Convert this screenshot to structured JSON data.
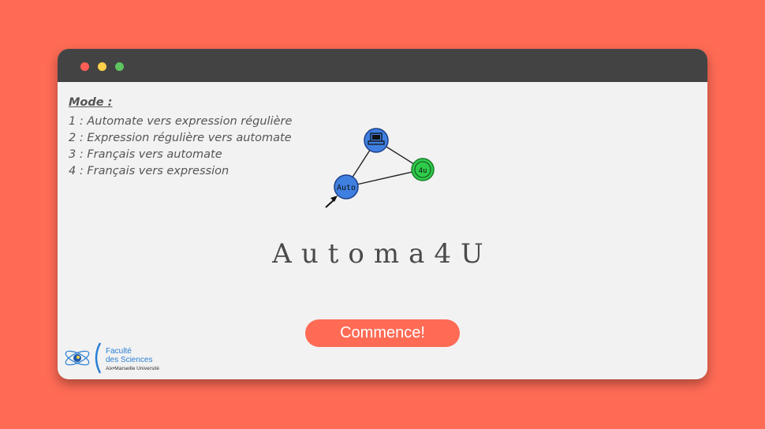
{
  "window": {
    "controls": [
      "close",
      "minimize",
      "maximize"
    ]
  },
  "mode": {
    "title": "Mode :",
    "options": [
      "1 : Automate vers expression régulière",
      "2 : Expression régulière vers automate",
      "3 : Français vers automate",
      "4 : Français vers expression"
    ]
  },
  "graph": {
    "nodes": [
      "laptop",
      "4u",
      "Auto"
    ],
    "labels": {
      "start": "Auto",
      "final": "4u"
    }
  },
  "app": {
    "title": "Automa4U",
    "start_button": "Commence!"
  },
  "logo": {
    "line1": "Faculté",
    "line2": "des Sciences",
    "line3": "Aix•Marseille Université"
  },
  "colors": {
    "background": "#ff6b55",
    "titlebar": "#434343",
    "node_blue": "#3f7fe0",
    "node_green": "#2ecc4a"
  }
}
